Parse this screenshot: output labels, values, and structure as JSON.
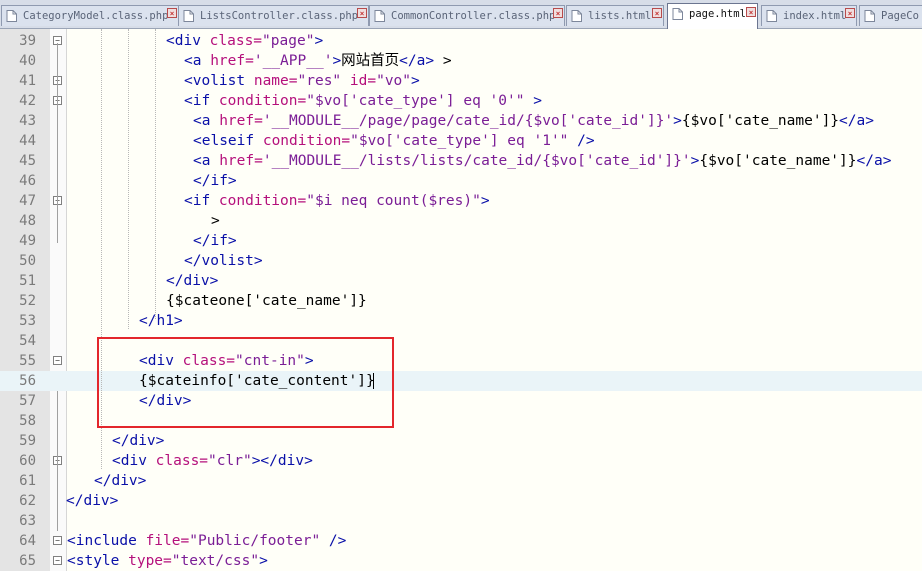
{
  "tabs": [
    {
      "label": "CategoryModel.class.php",
      "active": false
    },
    {
      "label": "ListsController.class.php",
      "active": false
    },
    {
      "label": "CommonController.class.php",
      "active": false
    },
    {
      "label": "lists.html",
      "active": false
    },
    {
      "label": "page.html",
      "active": true
    },
    {
      "label": "index.html",
      "active": false
    },
    {
      "label": "PageCo",
      "active": false
    }
  ],
  "lines": [
    {
      "num": "39",
      "tokens": [
        [
          "t",
          "<div "
        ],
        [
          "a",
          "class="
        ],
        [
          "v",
          "\"page\""
        ],
        [
          "t",
          ">"
        ]
      ]
    },
    {
      "num": "40",
      "tokens": [
        [
          "t",
          "<a "
        ],
        [
          "a",
          "href="
        ],
        [
          "v",
          "'__APP__'"
        ],
        [
          "t",
          ">"
        ],
        [
          "x",
          "网站首页"
        ],
        [
          "t",
          "</a>"
        ],
        [
          "x",
          " >"
        ]
      ]
    },
    {
      "num": "41",
      "tokens": [
        [
          "t",
          "<volist "
        ],
        [
          "a",
          "name="
        ],
        [
          "v",
          "\"res\" "
        ],
        [
          "a",
          "id="
        ],
        [
          "v",
          "\"vo\""
        ],
        [
          "t",
          ">"
        ]
      ]
    },
    {
      "num": "42",
      "tokens": [
        [
          "t",
          "<if "
        ],
        [
          "a",
          "condition="
        ],
        [
          "v",
          "\"$vo['cate_type'] eq '0'\""
        ],
        [
          "t",
          " >"
        ]
      ]
    },
    {
      "num": "43",
      "tokens": [
        [
          "t",
          "<a "
        ],
        [
          "a",
          "href="
        ],
        [
          "v",
          "'__MODULE__/page/page/cate_id/{$vo['cate_id']}'"
        ],
        [
          "t",
          ">"
        ],
        [
          "x",
          "{$vo['cate_name']}"
        ],
        [
          "t",
          "</a>"
        ]
      ]
    },
    {
      "num": "44",
      "tokens": [
        [
          "t",
          "<elseif "
        ],
        [
          "a",
          "condition="
        ],
        [
          "v",
          "\"$vo['cate_type'] eq '1'\""
        ],
        [
          "t",
          " />"
        ]
      ]
    },
    {
      "num": "45",
      "tokens": [
        [
          "t",
          "<a "
        ],
        [
          "a",
          "href="
        ],
        [
          "v",
          "'__MODULE__/lists/lists/cate_id/{$vo['cate_id']}'"
        ],
        [
          "t",
          ">"
        ],
        [
          "x",
          "{$vo['cate_name']}"
        ],
        [
          "t",
          "</a>"
        ]
      ]
    },
    {
      "num": "46",
      "tokens": [
        [
          "t",
          "</if>"
        ]
      ]
    },
    {
      "num": "47",
      "tokens": [
        [
          "t",
          "<if "
        ],
        [
          "a",
          "condition="
        ],
        [
          "v",
          "\"$i neq count($res)\""
        ],
        [
          "t",
          ">"
        ]
      ]
    },
    {
      "num": "48",
      "tokens": [
        [
          "x",
          ">"
        ]
      ]
    },
    {
      "num": "49",
      "tokens": [
        [
          "t",
          "</if>"
        ]
      ]
    },
    {
      "num": "50",
      "tokens": [
        [
          "t",
          "</volist>"
        ]
      ]
    },
    {
      "num": "51",
      "tokens": [
        [
          "t",
          "</div>"
        ]
      ]
    },
    {
      "num": "52",
      "tokens": [
        [
          "x",
          "{$cateone['cate_name']}"
        ]
      ]
    },
    {
      "num": "53",
      "tokens": [
        [
          "t",
          "</h1>"
        ]
      ]
    },
    {
      "num": "54",
      "tokens": []
    },
    {
      "num": "55",
      "tokens": [
        [
          "t",
          "<div "
        ],
        [
          "a",
          "class="
        ],
        [
          "v",
          "\"cnt-in\""
        ],
        [
          "t",
          ">"
        ]
      ]
    },
    {
      "num": "56",
      "tokens": [
        [
          "x",
          "{$cateinfo['cate_content']}"
        ]
      ]
    },
    {
      "num": "57",
      "tokens": [
        [
          "t",
          "</div>"
        ]
      ]
    },
    {
      "num": "58",
      "tokens": []
    },
    {
      "num": "59",
      "tokens": [
        [
          "t",
          "</div>"
        ]
      ]
    },
    {
      "num": "60",
      "tokens": [
        [
          "t",
          "<div "
        ],
        [
          "a",
          "class="
        ],
        [
          "v",
          "\"clr\""
        ],
        [
          "t",
          "></div>"
        ]
      ]
    },
    {
      "num": "61",
      "tokens": [
        [
          "t",
          "</div>"
        ]
      ]
    },
    {
      "num": "62",
      "tokens": [
        [
          "t",
          "</div>"
        ]
      ]
    },
    {
      "num": "63",
      "tokens": []
    },
    {
      "num": "64",
      "tokens": [
        [
          "t",
          "<include "
        ],
        [
          "a",
          "file="
        ],
        [
          "v",
          "\"Public/footer\""
        ],
        [
          "t",
          " />"
        ]
      ]
    },
    {
      "num": "65",
      "tokens": [
        [
          "t",
          "<style "
        ],
        [
          "a",
          "type="
        ],
        [
          "v",
          "\"text/css\""
        ],
        [
          "t",
          ">"
        ]
      ]
    }
  ],
  "colors": {
    "tag": "#0a10a8",
    "attribute": "#b5107c",
    "value": "#7b1e96",
    "text": "#000000",
    "highlight_box": "#e3262c",
    "current_line": "#eaf4f8"
  }
}
